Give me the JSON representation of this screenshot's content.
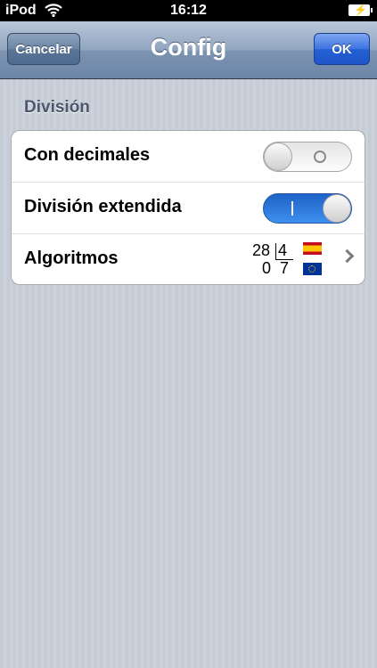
{
  "status_bar": {
    "carrier": "iPod",
    "time": "16:12"
  },
  "nav": {
    "title": "Config",
    "cancel_label": "Cancelar",
    "ok_label": "OK"
  },
  "section": {
    "header": "División",
    "rows": [
      {
        "label": "Con decimales",
        "toggle_on": false
      },
      {
        "label": "División extendida",
        "toggle_on": true
      },
      {
        "label": "Algoritmos"
      }
    ]
  },
  "algorithm_example": {
    "dividend": "28",
    "divisor": "4",
    "remainder": "0",
    "quotient": "7"
  },
  "icons": {
    "wifi": "wifi-icon",
    "battery": "battery-charging-icon",
    "chevron": "chevron-right-icon",
    "flag_es": "spain-flag-icon",
    "flag_eu": "eu-flag-icon"
  }
}
